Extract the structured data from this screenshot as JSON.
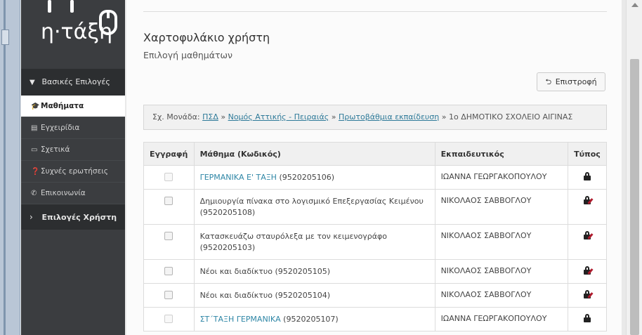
{
  "logo": {
    "text": "η·τάξη"
  },
  "sidebar": {
    "section1": "Βασικές Επιλογές",
    "items": [
      {
        "label": "Μαθήματα",
        "icon": "graduation-cap-icon",
        "glyph": "🎓"
      },
      {
        "label": "Εγχειρίδια",
        "icon": "file-icon",
        "glyph": "▤"
      },
      {
        "label": "Σχετικά",
        "icon": "credit-card-icon",
        "glyph": "▭"
      },
      {
        "label": "Συχνές ερωτήσεις",
        "icon": "question-icon",
        "glyph": "❓"
      },
      {
        "label": "Επικοινωνία",
        "icon": "phone-icon",
        "glyph": "✆"
      }
    ],
    "section2": "Επιλογές Χρήστη"
  },
  "main": {
    "title": "Χαρτοφυλάκιο χρήστη",
    "subtitle": "Επιλογή μαθημάτων",
    "back_label": "Επιστροφή",
    "breadcrumb": {
      "prefix": "Σχ. Μονάδα:",
      "links": [
        "ΠΣΔ",
        "Νομός Αττικής - Πειραιάς",
        "Πρωτοβάθμια εκπαίδευση"
      ],
      "separator": "»",
      "last": "1ο ΔΗΜΟΤΙΚΟ ΣΧΟΛΕΙΟ ΑΙΓΙΝΑΣ"
    },
    "table": {
      "headers": [
        "Εγγραφή",
        "Μάθημα (Κωδικός)",
        "Εκπαιδευτικός",
        "Τύπος"
      ],
      "rows": [
        {
          "course": "ΓΕΡΜΑΝΙΚΑ Ε' ΤΑΞΗ",
          "code": "(9520205106)",
          "teacher": "ΙΩΑΝΝΑ ΓΕΩΡΓΑΚΟΠΟΥΛΟΥ",
          "linked": true,
          "type": "lock"
        },
        {
          "course": "Δημιουργία πίνακα στο λογισμικό Επεξεργασίας Κειμένου",
          "code": "(9520205108)",
          "teacher": "ΝΙΚΟΛΑΟΣ ΣΑΒΒΟΓΛΟΥ",
          "linked": false,
          "type": "lock-edit"
        },
        {
          "course": "Κατασκευάζω σταυρόλεξα με τον κειμενογράφο",
          "code": "(9520205103)",
          "teacher": "ΝΙΚΟΛΑΟΣ ΣΑΒΒΟΓΛΟΥ",
          "linked": false,
          "type": "lock-edit"
        },
        {
          "course": "Νέοι και διαδίκτυο",
          "code": "(9520205105)",
          "teacher": "ΝΙΚΟΛΑΟΣ ΣΑΒΒΟΓΛΟΥ",
          "linked": false,
          "type": "lock-edit"
        },
        {
          "course": "Νέοι και διαδίκτυο",
          "code": "(9520205104)",
          "teacher": "ΝΙΚΟΛΑΟΣ ΣΑΒΒΟΓΛΟΥ",
          "linked": false,
          "type": "lock-edit"
        },
        {
          "course": "ΣΤ΄ΤΑΞΗ ΓΕΡΜΑΝΙΚΑ",
          "code": "(9520205107)",
          "teacher": "ΙΩΑΝΝΑ ΓΕΩΡΓΑΚΟΠΟΥΛΟΥ",
          "linked": true,
          "type": "lock"
        }
      ]
    }
  },
  "colors": {
    "link": "#2e86a6",
    "sidebar_bg": "#3b3d40",
    "lock_edit_accent": "#b01c2e"
  }
}
